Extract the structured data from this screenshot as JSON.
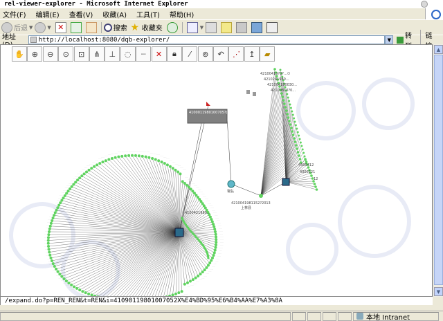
{
  "window": {
    "title": "rel-viewer-explorer - Microsoft Internet Explorer"
  },
  "menu": {
    "items": [
      "文件(F)",
      "编辑(E)",
      "查看(V)",
      "收藏(A)",
      "工具(T)",
      "帮助(H)"
    ]
  },
  "toolbar": {
    "back_label": "后退",
    "search_label": "搜索",
    "favorites_label": "收藏夹"
  },
  "address": {
    "label": "地址(D)",
    "url": "http://localhost:8080/dqb-explorer/",
    "go_label": "转到",
    "links_label": "链接"
  },
  "app_toolbar": {
    "tools": [
      "pan-tool",
      "zoom-in-tool",
      "zoom-out-tool",
      "zoom-fit-tool",
      "zoom-box-tool",
      "layout-tool",
      "tree-tool",
      "circle-layout-tool",
      "line-tool",
      "delete-tool",
      "lock-tool",
      "unlink-tool",
      "unlock-tool",
      "undo-tool",
      "filter-tool",
      "export-tool",
      "open-folder-tool"
    ]
  },
  "graph": {
    "label_box": "4100011980100705?(...)",
    "hub_label": "4100421980...",
    "mid_label_1": "4210041981152?2013",
    "mid_label_2": "上林县",
    "upper_labels": [
      "42100419?0?...ㅁ",
      "4210241980...",
      "421004190030...",
      "42100810?0..."
    ],
    "right_labels": [
      "4300412",
      "4300221",
      "12"
    ],
    "node_label_small": "電弘"
  },
  "status": {
    "link_text": "/expand.do?p=REN_REN&t=REN&i=41090119801007052X%E4%BD%95%E6%B4%AA%E7%A3%8A",
    "zone_label": "本地 Intranet"
  },
  "colors": {
    "node_green": "#5fd35f",
    "edge": "#333333",
    "hub": "#2b6a8a"
  }
}
